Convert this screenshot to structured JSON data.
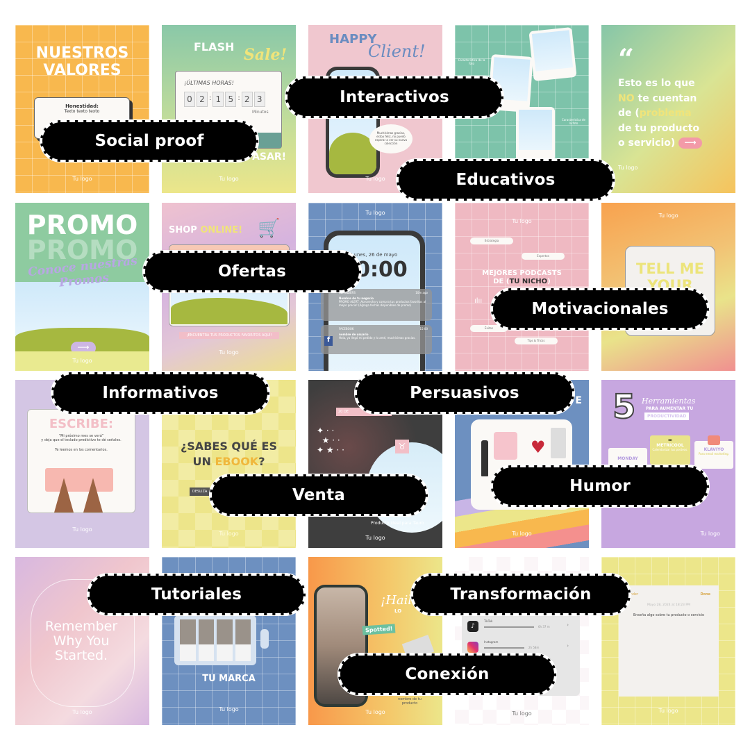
{
  "cards": {
    "valores": {
      "title": "NUESTROS VALORES",
      "box_title": "Honestidad:",
      "box_text": "Texto texto texto",
      "logo": "Tu logo"
    },
    "flash": {
      "title1": "FLASH",
      "title2": "Sale!",
      "timer_label": "¡ÚLTIMAS HORAS!",
      "timer": [
        "0",
        "2",
        ":",
        "1",
        "5",
        ":",
        "2",
        "3"
      ],
      "minutes": "Minutos",
      "footer": "ASAR!",
      "logo": "Tu logo"
    },
    "happy": {
      "title1": "HAPPY",
      "title2": "Client!",
      "bubble": "Muchísimas gracias, estoy feliz, no puedo esperar a ver su nueva colección",
      "logo": "Tu logo"
    },
    "fotos": {
      "caption1": "Característica de la foto",
      "caption2": "Característica de la foto"
    },
    "quote": {
      "mark": "“",
      "line1": "Esto es lo que",
      "no": "NO",
      "line2": " te cuentan",
      "line3a": "de (",
      "problema": "problema",
      "line4": "de tu producto",
      "line5": "o servicio)",
      "logo": "Tu logo"
    },
    "promo": {
      "title": "PROMO",
      "script": "Conoce nuestras Promos",
      "logo": "Tu logo"
    },
    "shop": {
      "shop": "SHOP ",
      "online": "ONLINE!",
      "banner": "¡ENCUENTRA TUS PRODUCTOS FAVORITOS AQUÍ!",
      "logo": "Tu logo"
    },
    "lock": {
      "logo": "Tu logo",
      "date": "Lunes, 26 de mayo",
      "time": "10:00",
      "n1_app": "REMINDERS",
      "n1_time": "10m ago",
      "n1_title": "Nombre de tu negocio",
      "n1_text": "PROMO ALERT ¡Aprovecha y compra tus productos favoritos al mejor precio! (Agrega fechas disponibles de promo)",
      "n2_app": "FACEBOOK",
      "n2_time": "15:00",
      "n2_title": "nombre de usuario",
      "n2_text": "Hola, ya llegó mi pedido y lo amé, muchísimas gracias."
    },
    "podcast": {
      "logo": "Tu logo",
      "tags": [
        "Estrategia",
        "Expertos",
        "Éxitos",
        "Tips & Tricks"
      ],
      "title": "MEJORES PODCASTS",
      "de": "DE (",
      "nicho": "TU NICHO",
      "close": ")"
    },
    "tell": {
      "logo": "Tu logo",
      "title": "TELL ME YOUR"
    },
    "escribe": {
      "title": "ESCRIBE:",
      "quote": "“Mi próximo mes se verá”",
      "line": "y deja que el teclado predictivo te dé señales.",
      "line2": "Te leemos en los comentarios.",
      "logo": "Tu logo"
    },
    "ebook": {
      "title1": "¿SABES QUÉ ES",
      "un": "UN ",
      "ebook": "EBOOK",
      "q": "?",
      "btn": "DESLIZA",
      "logo": "Tu logo"
    },
    "tauro": {
      "date": "20 DE",
      "product": "Producto ideal para Tauro",
      "logo": "Tu logo"
    },
    "regalo": {
      "title": "E",
      "logo": "Tu logo"
    },
    "herramientas": {
      "five": "5",
      "title": "Herramientas",
      "sub": "PARA AUMENTAR TU",
      "prod": "PRODUCTIVIDAD",
      "tools": [
        {
          "name": "MONDAY",
          "desc": "Manejo de"
        },
        {
          "name": "METRICOOL",
          "desc": "Calendarizar tus posteos."
        },
        {
          "name": "KLAVIYO",
          "desc": "Para email marketing."
        }
      ],
      "logo": "Tu logo"
    },
    "remember": {
      "text": "Remember Why You Started.",
      "logo": "Tu logo"
    },
    "marca": {
      "title": "TU MARCA",
      "logo": "Tu logo"
    },
    "hailey": {
      "title": "¡Hail",
      "sub": "LO",
      "spotted": "Spotted!",
      "product": "nombre de tu producto",
      "logo": "Tu logo"
    },
    "screen": {
      "apps": [
        {
          "name": "TikTok",
          "time": "6h 37 m"
        },
        {
          "name": "Instagram",
          "time": "2h 58m"
        }
      ],
      "logo": "Tu logo"
    },
    "reminder": {
      "back": "Reminder",
      "done": "Done",
      "date": "Mayo 28, 2024 at 18:23 PM",
      "text": "Enseña algo sobre tu producto o servicio",
      "logo": "Tu logo"
    }
  },
  "labels": [
    "Social proof",
    "Interactivos",
    "Educativos",
    "Ofertas",
    "Motivacionales",
    "Informativos",
    "Persuasivos",
    "Venta",
    "Humor",
    "Tutoriales",
    "Transformación",
    "Conexión"
  ]
}
